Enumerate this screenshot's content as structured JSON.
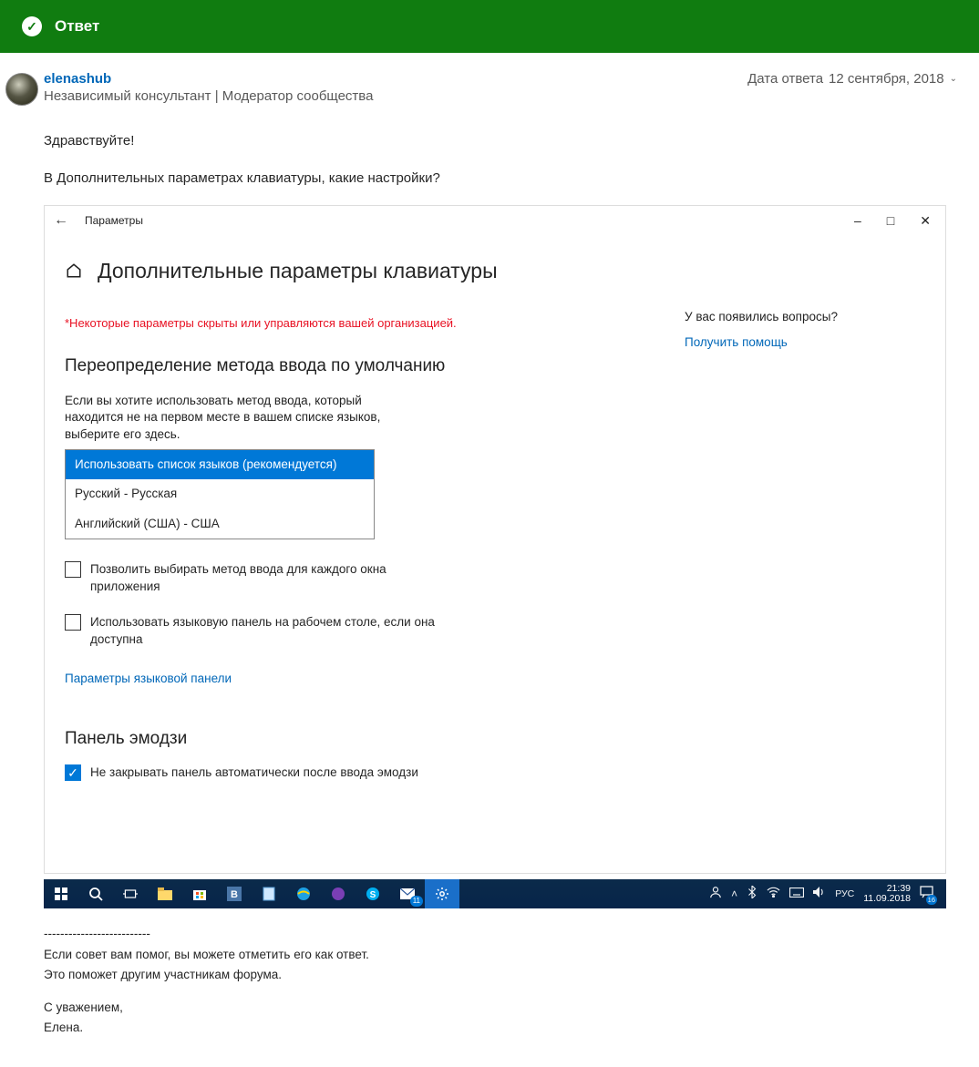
{
  "answer_header": {
    "label": "Ответ"
  },
  "user": {
    "name": "elenashub",
    "role": "Независимый консультант | Модератор сообщества"
  },
  "date_prefix": "Дата ответа",
  "date_value": "12 сентября, 2018",
  "post": {
    "greeting": "Здравствуйте!",
    "line1": "В Дополнительных параметрах клавиатуры, какие настройки?"
  },
  "settings": {
    "app_title": "Параметры",
    "page_title": "Дополнительные параметры клавиатуры",
    "restricted_notice": "*Некоторые параметры скрыты или управляются вашей организацией.",
    "section1_title": "Переопределение метода ввода по умолчанию",
    "section1_desc": "Если вы хотите использовать метод ввода, который находится не на первом месте в вашем списке языков, выберите его здесь.",
    "dropdown": {
      "selected": "Использовать список языков (рекомендуется)",
      "opt1": "Русский - Русская",
      "opt2": "Английский (США) - США"
    },
    "checkbox1": "Позволить выбирать метод ввода для каждого окна приложения",
    "checkbox2": "Использовать языковую панель на рабочем столе, если она доступна",
    "lang_panel_link": "Параметры языковой панели",
    "emoji_title": "Панель эмодзи",
    "emoji_checkbox": "Не закрывать панель автоматически после ввода эмодзи",
    "sidebar": {
      "questions": "У вас появились вопросы?",
      "help_link": "Получить помощь"
    }
  },
  "taskbar": {
    "lang": "РУС",
    "time": "21:39",
    "date": "11.09.2018",
    "tray_badge": "16",
    "mail_badge": "11"
  },
  "signature": {
    "divider": "--------------------------",
    "line1": "Если совет вам помог, вы можете отметить его как ответ.",
    "line2": "Это поможет другим участникам форума.",
    "regards": "С уважением,",
    "name": "Елена."
  }
}
